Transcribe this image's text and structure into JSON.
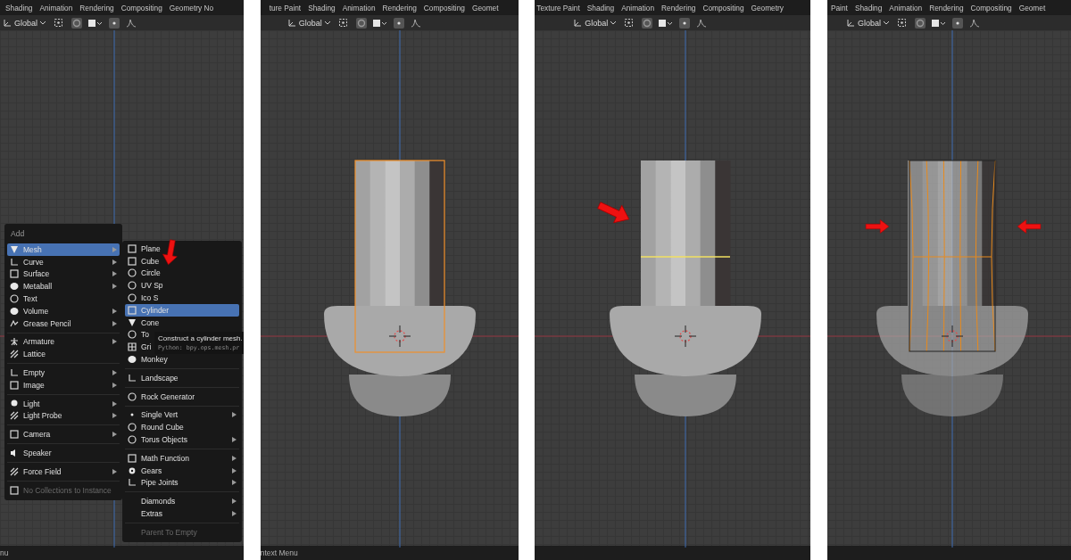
{
  "panels": [
    {
      "tabs": [
        "Shading",
        "Animation",
        "Rendering",
        "Compositing",
        "Geometry No"
      ],
      "toolbar": {
        "orientation": "Global"
      },
      "status": "nu",
      "viewport": {
        "kind": "empty"
      },
      "add_menu": {
        "title": "Add",
        "groups": [
          {
            "items": [
              {
                "label": "Mesh",
                "submenu": true,
                "selected": true,
                "disabled": false
              },
              {
                "label": "Curve",
                "submenu": true,
                "selected": false,
                "disabled": false
              },
              {
                "label": "Surface",
                "submenu": true,
                "selected": false,
                "disabled": false
              },
              {
                "label": "Metaball",
                "submenu": true,
                "selected": false,
                "disabled": false
              },
              {
                "label": "Text",
                "submenu": false,
                "selected": false,
                "disabled": false
              },
              {
                "label": "Volume",
                "submenu": true,
                "selected": false,
                "disabled": false
              },
              {
                "label": "Grease Pencil",
                "submenu": true,
                "selected": false,
                "disabled": false
              }
            ]
          },
          {
            "items": [
              {
                "label": "Armature",
                "submenu": true,
                "selected": false,
                "disabled": false
              },
              {
                "label": "Lattice",
                "submenu": false,
                "selected": false,
                "disabled": false
              }
            ]
          },
          {
            "items": [
              {
                "label": "Empty",
                "submenu": true,
                "selected": false,
                "disabled": false
              },
              {
                "label": "Image",
                "submenu": true,
                "selected": false,
                "disabled": false
              }
            ]
          },
          {
            "items": [
              {
                "label": "Light",
                "submenu": true,
                "selected": false,
                "disabled": false
              },
              {
                "label": "Light Probe",
                "submenu": true,
                "selected": false,
                "disabled": false
              }
            ]
          },
          {
            "items": [
              {
                "label": "Camera",
                "submenu": true,
                "selected": false,
                "disabled": false
              }
            ]
          },
          {
            "items": [
              {
                "label": "Speaker",
                "submenu": false,
                "selected": false,
                "disabled": false
              }
            ]
          },
          {
            "items": [
              {
                "label": "Force Field",
                "submenu": true,
                "selected": false,
                "disabled": false
              }
            ]
          },
          {
            "items": [
              {
                "label": "No Collections to Instance",
                "submenu": false,
                "selected": false,
                "disabled": true
              }
            ]
          }
        ]
      },
      "mesh_menu": {
        "groups": [
          {
            "items": [
              {
                "label": "Plane",
                "submenu": false,
                "selected": false,
                "disabled": false
              },
              {
                "label": "Cube",
                "submenu": false,
                "selected": false,
                "disabled": false
              },
              {
                "label": "Circle",
                "submenu": false,
                "selected": false,
                "disabled": false
              },
              {
                "label": "UV Sp",
                "submenu": false,
                "selected": false,
                "disabled": false
              },
              {
                "label": "Ico S",
                "submenu": false,
                "selected": false,
                "disabled": false
              },
              {
                "label": "Cylinder",
                "submenu": false,
                "selected": true,
                "disabled": false
              },
              {
                "label": "Cone",
                "submenu": false,
                "selected": false,
                "disabled": false
              },
              {
                "label": "To",
                "selected": false,
                "disabled": false
              },
              {
                "label": "Gri",
                "selected": false,
                "disabled": false
              },
              {
                "label": "Monkey",
                "submenu": false,
                "selected": false,
                "disabled": false
              }
            ]
          },
          {
            "items": [
              {
                "label": "Landscape",
                "submenu": false,
                "selected": false,
                "disabled": false
              }
            ]
          },
          {
            "items": [
              {
                "label": "Rock Generator",
                "submenu": false,
                "selected": false,
                "disabled": false
              }
            ]
          },
          {
            "items": [
              {
                "label": "Single Vert",
                "submenu": true,
                "selected": false,
                "disabled": false
              },
              {
                "label": "Round Cube",
                "submenu": false,
                "selected": false,
                "disabled": false
              },
              {
                "label": "Torus Objects",
                "submenu": true,
                "selected": false,
                "disabled": false
              }
            ]
          },
          {
            "items": [
              {
                "label": "Math Function",
                "submenu": true,
                "selected": false,
                "disabled": false
              },
              {
                "label": "Gears",
                "submenu": true,
                "selected": false,
                "disabled": false
              },
              {
                "label": "Pipe Joints",
                "submenu": true,
                "selected": false,
                "disabled": false
              }
            ]
          },
          {
            "items": [
              {
                "label": "Diamonds",
                "submenu": true,
                "selected": false,
                "disabled": false
              },
              {
                "label": "Extras",
                "submenu": true,
                "selected": false,
                "disabled": false
              }
            ]
          },
          {
            "items": [
              {
                "label": "Parent To Empty",
                "submenu": false,
                "selected": false,
                "disabled": true
              }
            ]
          }
        ]
      },
      "tooltip": {
        "title": "Construct a cylinder mesh.",
        "python": "Python: bpy.ops.mesh.pr"
      },
      "arrows": [
        {
          "kind": "down"
        }
      ]
    },
    {
      "tabs": [
        "ture Paint",
        "Shading",
        "Animation",
        "Rendering",
        "Compositing",
        "Geomet"
      ],
      "toolbar": {
        "orientation": "Global"
      },
      "status": "ntext Menu",
      "viewport": {
        "kind": "selected"
      }
    },
    {
      "tabs": [
        "Texture Paint",
        "Shading",
        "Animation",
        "Rendering",
        "Compositing",
        "Geometry"
      ],
      "toolbar": {
        "orientation": "Global"
      },
      "viewport": {
        "kind": "loopcut"
      },
      "arrows": [
        {
          "kind": "down-right"
        }
      ]
    },
    {
      "tabs": [
        "Paint",
        "Shading",
        "Animation",
        "Rendering",
        "Compositing",
        "Geomet"
      ],
      "toolbar": {
        "orientation": "Global"
      },
      "viewport": {
        "kind": "scaled"
      },
      "arrows": [
        {
          "kind": "right"
        },
        {
          "kind": "left"
        }
      ]
    }
  ]
}
